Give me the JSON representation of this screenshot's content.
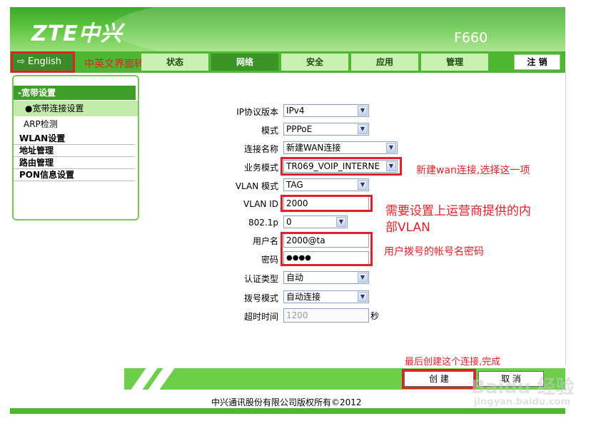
{
  "header": {
    "logo": "ZTE中兴",
    "model": "F660"
  },
  "nav": {
    "language_button": "⇨ English",
    "language_note": "中英文界面转换",
    "tabs": [
      "状态",
      "网络",
      "安全",
      "应用",
      "管理"
    ],
    "active_tab": "网络",
    "logout": "注 销"
  },
  "sidebar": {
    "section": "-宽带设置",
    "active_item": "●宽带连接设置",
    "items": [
      "ARP检测"
    ],
    "groups": [
      "WLAN设置",
      "地址管理",
      "路由管理",
      "PON信息设置"
    ]
  },
  "form": {
    "ip_version": {
      "label": "IP协议版本",
      "value": "IPv4"
    },
    "mode": {
      "label": "模式",
      "value": "PPPoE"
    },
    "conn_name": {
      "label": "连接名称",
      "value": "新建WAN连接"
    },
    "service_mode": {
      "label": "业务模式",
      "value": "TR069_VOIP_INTERNE"
    },
    "vlan_mode": {
      "label": "VLAN 模式",
      "value": "TAG"
    },
    "vlan_id": {
      "label": "VLAN ID",
      "value": "2000"
    },
    "priority": {
      "label": "802.1p",
      "value": "0"
    },
    "username": {
      "label": "用户名",
      "value": "2000@ta"
    },
    "password": {
      "label": "密码",
      "value": "●●●●"
    },
    "auth_type": {
      "label": "认证类型",
      "value": "自动"
    },
    "dial_mode": {
      "label": "拨号模式",
      "value": "自动连接"
    },
    "timeout": {
      "label": "超时时间",
      "value": "1200",
      "unit": "秒"
    }
  },
  "annotations": {
    "service_note": "新建wan连接,选择这一项",
    "vlan_note_1": "需要设置上运营商提供的内",
    "vlan_note_2": "部VLAN",
    "account_note": "用户拨号的帐号名密码",
    "create_note": "最后创建这个连接,完成"
  },
  "footer": {
    "create_button": "创 建",
    "cancel_button": "取 消",
    "copyright": "中兴通讯股份有限公司版权所有©2012"
  },
  "watermark": {
    "line1": "Baidu 经验",
    "line2": "jingyan.baidu.com"
  },
  "colors": {
    "brand_green": "#4cb832",
    "annotation_red": "#e0202a"
  }
}
